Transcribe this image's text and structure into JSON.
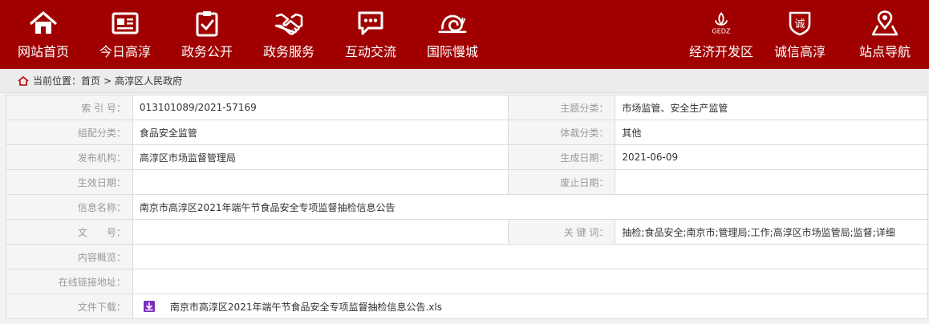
{
  "nav": {
    "left": [
      {
        "label": "网站首页",
        "icon": "home-icon"
      },
      {
        "label": "今日高淳",
        "icon": "newspaper-icon"
      },
      {
        "label": "政务公开",
        "icon": "clipboard-check-icon"
      },
      {
        "label": "政务服务",
        "icon": "handshake-icon"
      },
      {
        "label": "互动交流",
        "icon": "chat-bubble-icon"
      },
      {
        "label": "国际慢城",
        "icon": "snail-icon"
      }
    ],
    "right": [
      {
        "label": "经济开发区",
        "icon": "gedz-logo-icon",
        "logo_text": "GEDZ"
      },
      {
        "label": "诚信高淳",
        "icon": "integrity-shield-icon",
        "badge_char": "诚"
      },
      {
        "label": "站点导航",
        "icon": "map-pin-icon"
      }
    ]
  },
  "breadcrumb": {
    "prefix": "当前位置：",
    "home": "首页",
    "separator": ">",
    "current": "高淳区人民政府"
  },
  "meta": {
    "index_label": "索 引 号：",
    "index_value": "013101089/2021-57169",
    "topic_label": "主题分类：",
    "topic_value": "市场监管、安全生产监管",
    "org_class_label": "组配分类：",
    "org_class_value": "食品安全监管",
    "genre_label": "体裁分类：",
    "genre_value": "其他",
    "publisher_label": "发布机构：",
    "publisher_value": "高淳区市场监督管理局",
    "created_label": "生成日期：",
    "created_value": "2021-06-09",
    "effective_label": "生效日期：",
    "effective_value": "",
    "abolish_label": "废止日期：",
    "abolish_value": "",
    "title_label": "信息名称：",
    "title_value": "南京市高淳区2021年端午节食品安全专项监督抽检信息公告",
    "docno_label": "文　　号：",
    "docno_value": "",
    "keywords_label": "关 键 词：",
    "keywords_value": "抽检;食品安全;南京市;管理局;工作;高淳区市场监管局;监督;详细",
    "summary_label": "内容概览：",
    "summary_value": "",
    "link_label": "在线链接地址：",
    "link_value": "",
    "download_label": "文件下载：",
    "download_file": "南京市高淳区2021年端午节食品安全专项监督抽检信息公告.xls"
  },
  "colors": {
    "nav_bg": "#a00000",
    "breadcrumb_icon": "#c00000",
    "download_icon": "#7b2fbf"
  }
}
